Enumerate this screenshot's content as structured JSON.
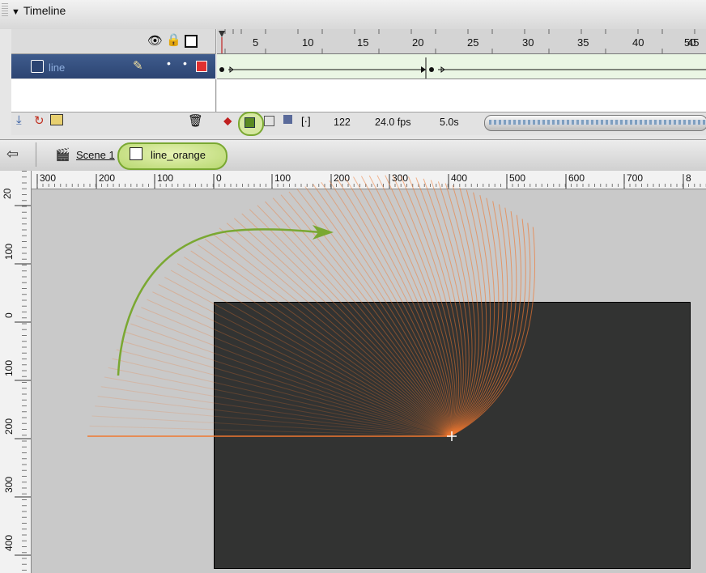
{
  "timeline": {
    "title": "Timeline",
    "layer": {
      "name": "line"
    },
    "frame_numbers": [
      "5",
      "10",
      "15",
      "20",
      "25",
      "30",
      "35",
      "40",
      "45",
      "50"
    ],
    "status": {
      "current_frame": "122",
      "frame_rate": "24.0 fps",
      "elapsed": "5.0s"
    }
  },
  "edit_bar": {
    "scene": "Scene 1",
    "symbol": "line_orange"
  },
  "rulers": {
    "horizontal": [
      "300",
      "200",
      "100",
      "0",
      "100",
      "200",
      "300",
      "400",
      "500",
      "600",
      "700",
      "8"
    ],
    "vertical": [
      "20",
      "100",
      "0",
      "100",
      "200",
      "300",
      "400"
    ]
  },
  "colors": {
    "stage": "#323332",
    "pasteboard": "#c9c9c9",
    "line_accent": "#f07830",
    "arrow": "#7aa832"
  }
}
